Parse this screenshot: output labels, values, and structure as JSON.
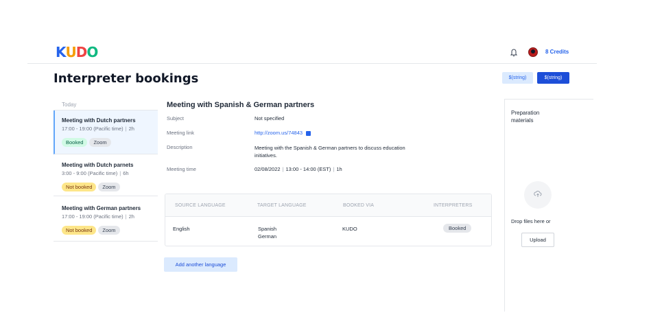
{
  "app": {
    "logo_letters": [
      {
        "ch": "K",
        "color": "#2563eb"
      },
      {
        "ch": "U",
        "color": "#f59e0b"
      },
      {
        "ch": "D",
        "color": "#ef4444"
      },
      {
        "ch": "O",
        "color": "#10b981"
      }
    ],
    "credits": "8 Credits"
  },
  "header": {
    "title": "Interpreter bookings",
    "button_secondary": "$(string)",
    "button_primary": "$(string)"
  },
  "bookings": {
    "group_label": "Today",
    "items": [
      {
        "title": "Meeting with Dutch partners",
        "time": "17:00 - 19:00  (Pacific time)",
        "duration": "2h",
        "status": "Booked",
        "platform": "Zoom"
      },
      {
        "title": "Meeting with Dutch parnets",
        "time": "3:00 - 9:00  (Pacific time)",
        "duration": "6h",
        "status": "Not booked",
        "platform": "Zoom"
      },
      {
        "title": "Meeting with German partners",
        "time": "17:00 - 19:00  (Pacific time)",
        "duration": "2h",
        "status": "Not booked",
        "platform": "Zoom"
      }
    ]
  },
  "detail": {
    "title": "Meeting with Spanish & German partners",
    "subject_label": "Subject",
    "subject_value": "Not specified",
    "link_label": "Meeting link",
    "link_value": "http://zoom.us/74843",
    "description_label": "Description",
    "description_value": "Meeting with the Spanish & German partners to discuss education initiatives.",
    "time_label": "Meeting time",
    "time_date": "02/08/2022",
    "time_range": "13:00 - 14:00 (EST)",
    "time_duration": "1h"
  },
  "languages": {
    "headers": {
      "source": "SOURCE LANGUAGE",
      "target": "TARGET LANGUAGE",
      "booked_via": "BOOKED VIA",
      "interpreters": "INTERPRETERS"
    },
    "row": {
      "source": "English",
      "target_1": "Spanish",
      "target_2": "German",
      "booked_via": "KUDO",
      "interpreters": "Booked"
    },
    "add_button": "Add another language"
  },
  "preparation": {
    "title": "Preparation materials",
    "drop_text": "Drop files here or",
    "upload_button": "Upload"
  }
}
